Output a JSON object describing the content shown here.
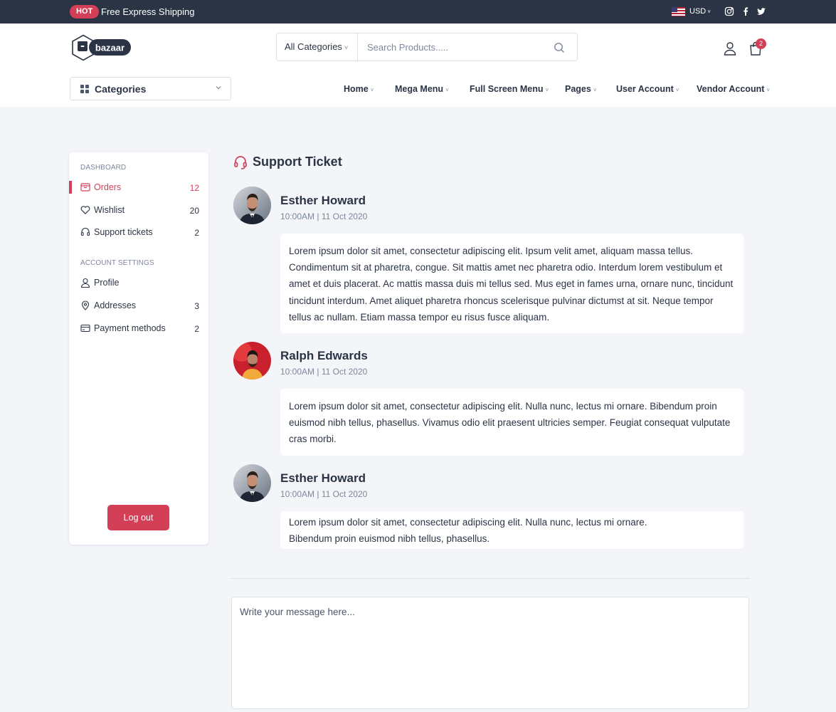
{
  "topbar": {
    "badge": "HOT",
    "promo": "Free Express Shipping",
    "currency": "USD",
    "chevron": "˅",
    "icons": [
      "flag-us-icon",
      "instagram-icon",
      "facebook-icon",
      "twitter-icon"
    ]
  },
  "header": {
    "logo_text": "bazaar",
    "search": {
      "category": "All Categories",
      "placeholder": "Search Products....."
    },
    "cart_count": "2"
  },
  "nav": {
    "categories_label": "Categories",
    "items": [
      {
        "label": "Home"
      },
      {
        "label": "Mega Menu"
      },
      {
        "label": "Full Screen Menu"
      },
      {
        "label": "Pages"
      },
      {
        "label": "User Account"
      },
      {
        "label": "Vendor Account"
      }
    ]
  },
  "sidebar": {
    "dashboard_title": "DASHBOARD",
    "dashboard_items": [
      {
        "label": "Orders",
        "count": "12",
        "icon": "shopping-bag-icon"
      },
      {
        "label": "Wishlist",
        "count": "20",
        "icon": "heart-icon"
      },
      {
        "label": "Support tickets",
        "count": "2",
        "icon": "headset-icon"
      }
    ],
    "account_title": "ACCOUNT SETTINGS",
    "account_items": [
      {
        "label": "Profile",
        "count": "",
        "icon": "user-icon"
      },
      {
        "label": "Addresses",
        "count": "3",
        "icon": "location-pin-icon"
      },
      {
        "label": "Payment methods",
        "count": "2",
        "icon": "credit-card-icon"
      }
    ],
    "logout_label": "Log out"
  },
  "main": {
    "title": "Support Ticket",
    "messages": [
      {
        "name": "Esther Howard",
        "time": "10:00AM | 11 Oct 2020",
        "text": "Lorem ipsum dolor sit amet, consectetur adipiscing elit. Ipsum velit amet, aliquam massa tellus. Condimentum sit at pharetra, congue. Sit mattis amet nec pharetra odio. Interdum lorem vestibulum et amet et duis placerat. Ac mattis massa duis mi tellus sed. Mus eget in fames urna, ornare nunc, tincidunt tincidunt interdum. Amet aliquet pharetra rhoncus scelerisque pulvinar dictumst at sit. Neque tempor tellus ac nullam. Etiam massa tempor eu risus fusce aliquam."
      },
      {
        "name": "Ralph Edwards",
        "time": "10:00AM | 11 Oct 2020",
        "text": "Lorem ipsum dolor sit amet, consectetur adipiscing elit. Nulla nunc, lectus mi ornare. Bibendum proin euismod nibh tellus, phasellus. Vivamus odio elit praesent ultricies semper. Feugiat consequat vulputate cras morbi."
      },
      {
        "name": "Esther Howard",
        "time": "10:00AM | 11 Oct 2020",
        "text": "Lorem ipsum dolor sit amet, consectetur adipiscing elit. Nulla nunc, lectus mi ornare. Bibendum proin euismod nibh tellus, phasellus."
      }
    ],
    "reply_placeholder": "Write your message here..."
  },
  "colors": {
    "primary": "#d23f57",
    "dark": "#2b3445",
    "muted": "#7d879c",
    "background": "#f3f5f9"
  }
}
